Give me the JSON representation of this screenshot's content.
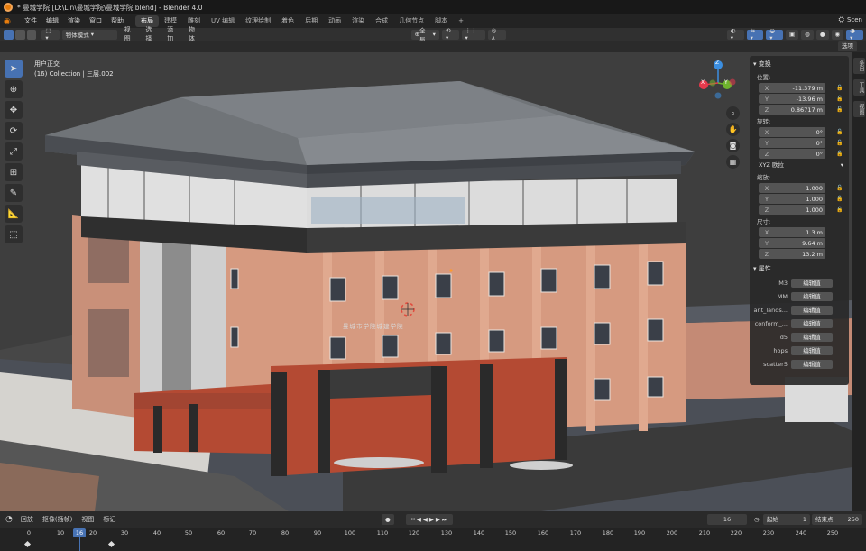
{
  "window": {
    "title": "* 曼城学院 [D:\\Lin\\曼城学院\\曼城学院.blend] - Blender 4.0"
  },
  "menu": {
    "items": [
      "文件",
      "编辑",
      "渲染",
      "窗口",
      "帮助"
    ]
  },
  "workspaces": [
    "布局",
    "建模",
    "雕刻",
    "UV 编辑",
    "纹理绘制",
    "着色",
    "后期",
    "动画",
    "渲染",
    "合成",
    "几何节点",
    "脚本",
    "+"
  ],
  "scene_label": "Scen",
  "view_header": {
    "mode": "物体模式",
    "menus": [
      "视图",
      "选择",
      "添加",
      "物体"
    ],
    "transform_orientation": "全局",
    "options_button": "选项"
  },
  "viewport": {
    "view_name": "用户正交",
    "collection_info": "(16) Collection | 三层.002",
    "gizmo_axes": {
      "x": "X",
      "y": "Y",
      "z": "Z"
    },
    "building_sign": "曼城市学院城建学院"
  },
  "colors": {
    "accent": "#4772b3",
    "brick": "#d69a80",
    "roof": "#707478",
    "gate": "#b44a33",
    "x_axis": "#e8394c",
    "y_axis": "#6fb32d",
    "z_axis": "#3b8ee0"
  },
  "toolbar": [
    "cursor-select",
    "cursor-3d",
    "move",
    "rotate",
    "scale",
    "transform",
    "annotate",
    "measure",
    "add-cube"
  ],
  "npanel": {
    "transform_title": "变换",
    "location_label": "位置:",
    "location": [
      {
        "axis": "X",
        "value": "-11.379 m"
      },
      {
        "axis": "Y",
        "value": "-13.96 m"
      },
      {
        "axis": "Z",
        "value": "0.86717 m"
      }
    ],
    "rotation_label": "旋转:",
    "rotation": [
      {
        "axis": "X",
        "value": "0°"
      },
      {
        "axis": "Y",
        "value": "0°"
      },
      {
        "axis": "Z",
        "value": "0°"
      }
    ],
    "rotation_mode": "XYZ 欧拉",
    "scale_label": "缩放:",
    "scale": [
      {
        "axis": "X",
        "value": "1.000"
      },
      {
        "axis": "Y",
        "value": "1.000"
      },
      {
        "axis": "Z",
        "value": "1.000"
      }
    ],
    "dimensions_label": "尺寸:",
    "dimensions": [
      {
        "axis": "X",
        "value": "1.3 m"
      },
      {
        "axis": "Y",
        "value": "9.64 m"
      },
      {
        "axis": "Z",
        "value": "13.2 m"
      }
    ],
    "properties_title": "属性",
    "properties": [
      {
        "name": "M3",
        "button": "编辑值"
      },
      {
        "name": "MM",
        "button": "编辑值"
      },
      {
        "name": "ant_lands...",
        "button": "编辑值"
      },
      {
        "name": "conform_...",
        "button": "编辑值"
      },
      {
        "name": "d5",
        "button": "编辑值"
      },
      {
        "name": "hops",
        "button": "编辑值"
      },
      {
        "name": "scatter5",
        "button": "编辑值"
      }
    ]
  },
  "vertical_tabs": [
    "条目",
    "工具",
    "视图"
  ],
  "timeline": {
    "menus": [
      "回放",
      "抠像(插帧)",
      "视图",
      "标记"
    ],
    "current_frame": "16",
    "start_label": "起始",
    "start": "1",
    "end_label": "结束点",
    "end": "250",
    "ruler_ticks": [
      "0",
      "10",
      "16",
      "20",
      "30",
      "40",
      "50",
      "60",
      "70",
      "80",
      "90",
      "100",
      "110",
      "120",
      "130",
      "140",
      "150",
      "160",
      "170",
      "180",
      "190",
      "200",
      "210",
      "220",
      "230",
      "240",
      "250"
    ]
  }
}
